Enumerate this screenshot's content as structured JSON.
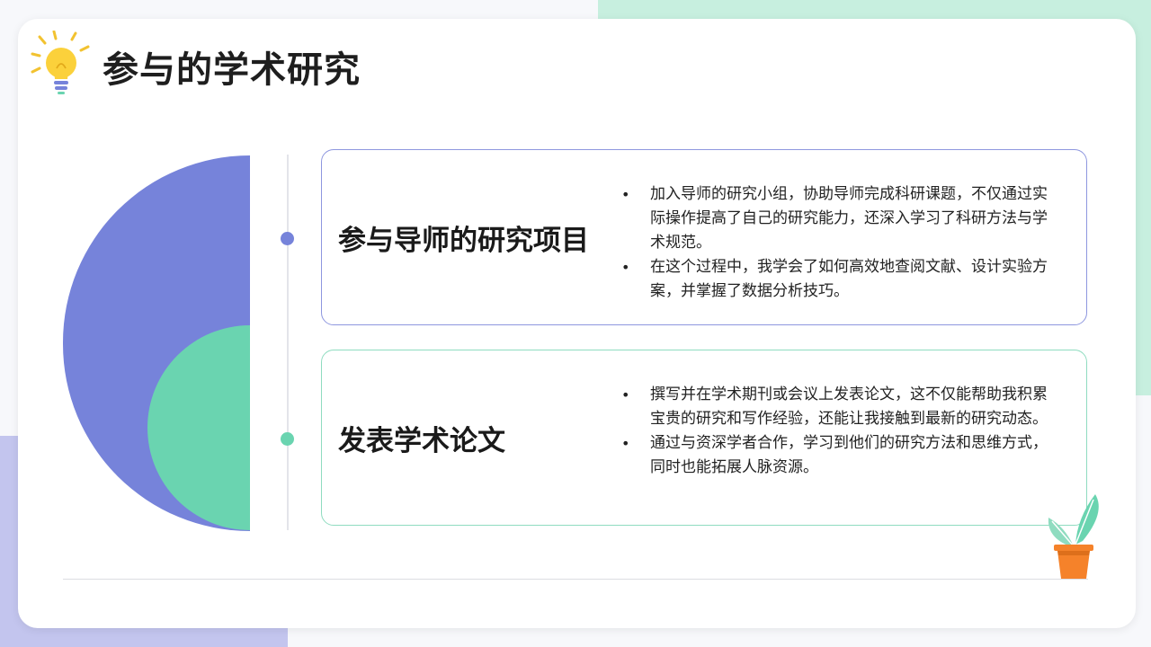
{
  "slide": {
    "title": "参与的学术研究",
    "colors": {
      "accent_purple": "#7683da",
      "accent_green": "#6ad4b0",
      "plant_pot": "#f5822a"
    }
  },
  "items": [
    {
      "heading": "参与导师的研究项目",
      "bullets": [
        "加入导师的研究小组，协助导师完成科研课题，不仅通过实际操作提高了自己的研究能力，还深入学习了科研方法与学术规范。",
        "在这个过程中，我学会了如何高效地查阅文献、设计实验方案，并掌握了数据分析技巧。"
      ]
    },
    {
      "heading": "发表学术论文",
      "bullets": [
        "撰写并在学术期刊或会议上发表论文，这不仅能帮助我积累宝贵的研究和写作经验，还能让我接触到最新的研究动态。",
        "通过与资深学者合作，学习到他们的研究方法和思维方式，同时也能拓展人脉资源。"
      ]
    }
  ]
}
